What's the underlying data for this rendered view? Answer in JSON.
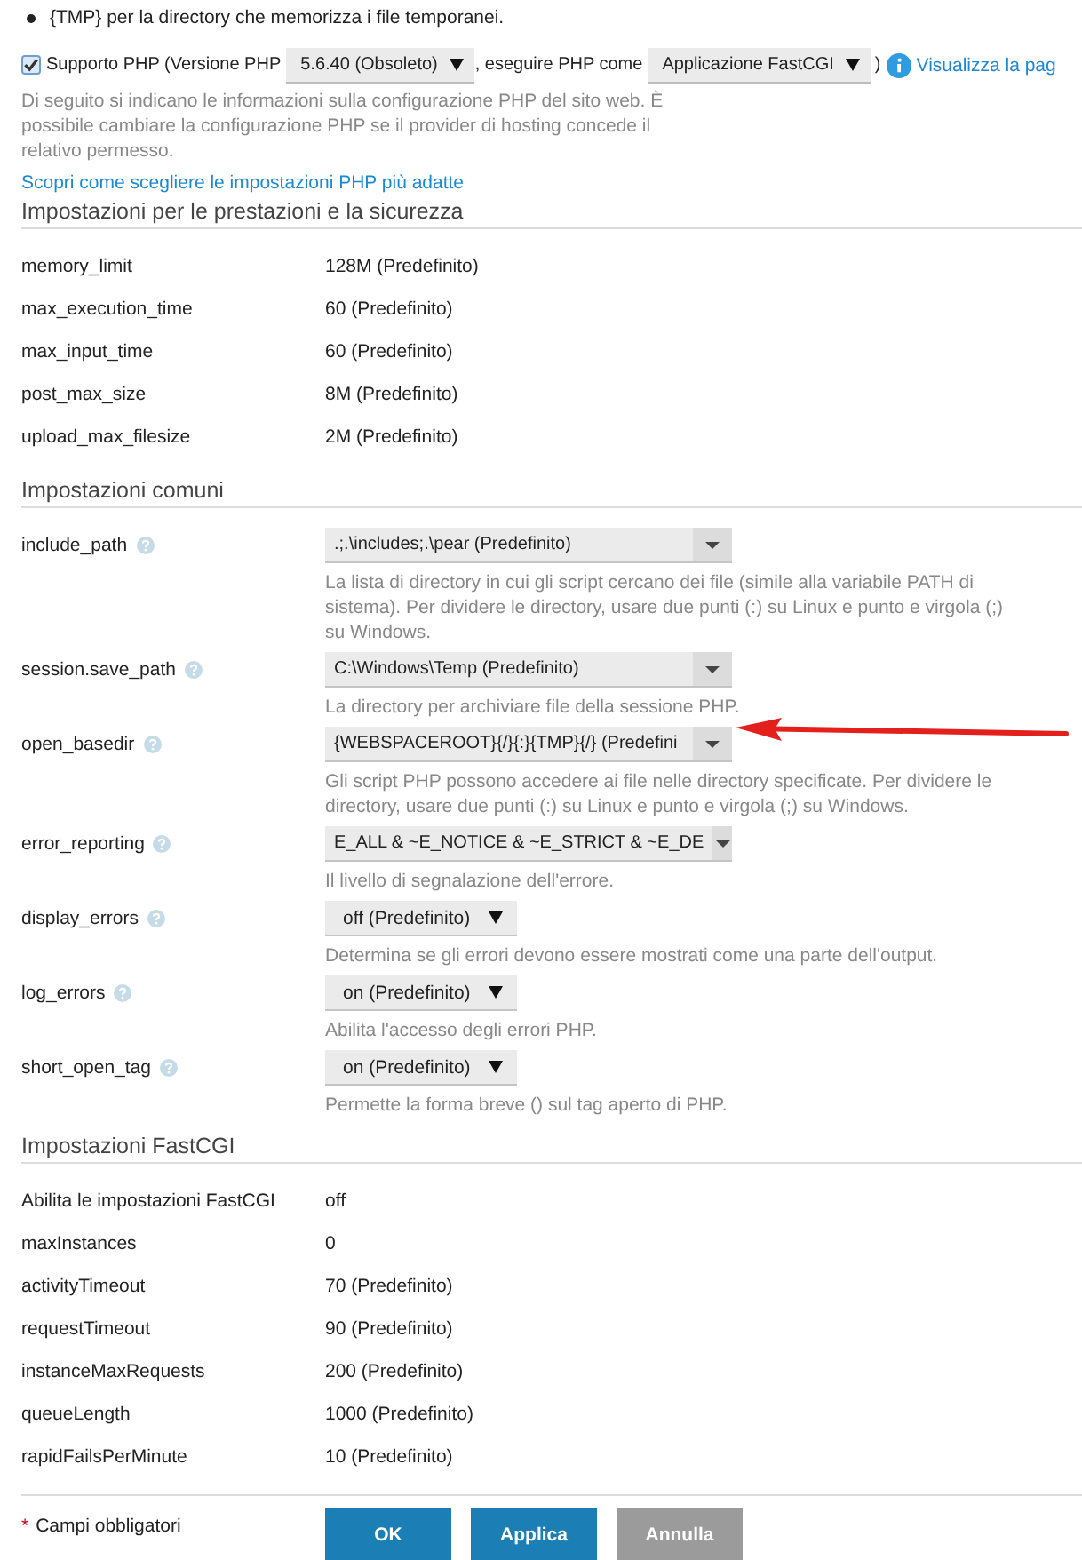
{
  "bullets": [
    "{TMP} per la directory che memorizza i file temporanei."
  ],
  "php_support": {
    "checked": true,
    "label": "Supporto PHP (Versione PHP",
    "version": "5.6.40 (Obsoleto)",
    "separator": ", eseguire PHP come",
    "handler": "Applicazione FastCGI",
    "closing": ")",
    "link": "Visualizza la pag"
  },
  "description": "Di seguito si indicano le informazioni sulla configurazione PHP del sito web. È possibile cambiare la configurazione PHP se il provider di hosting concede il relativo permesso.",
  "guide_link": "Scopri come scegliere le impostazioni PHP più adatte",
  "sections": [
    {
      "title": "Impostazioni per le prestazioni e la sicurezza",
      "rows": [
        {
          "kind": "text",
          "help": false,
          "name": "memory_limit",
          "value": "128M (Predefinito)"
        },
        {
          "kind": "text",
          "help": false,
          "name": "max_execution_time",
          "value": "60 (Predefinito)"
        },
        {
          "kind": "text",
          "help": false,
          "name": "max_input_time",
          "value": "60 (Predefinito)"
        },
        {
          "kind": "text",
          "help": false,
          "name": "post_max_size",
          "value": "8M (Predefinito)"
        },
        {
          "kind": "text",
          "help": false,
          "name": "upload_max_filesize",
          "value": "2M (Predefinito)"
        }
      ]
    },
    {
      "title": "Impostazioni comuni",
      "rows": [
        {
          "kind": "combo",
          "help": true,
          "name": "include_path",
          "value": ".;.\\includes;.\\pear (Predefinito)",
          "description": "La lista di directory in cui gli script cercano dei file (simile alla variabile PATH di sistema). Per dividere le directory, usare due punti (:) su Linux e punto e virgola (;) su Windows."
        },
        {
          "kind": "combo",
          "help": true,
          "name": "session.save_path",
          "value": "C:\\Windows\\Temp (Predefinito)",
          "description": "La directory per archiviare file della sessione PHP."
        },
        {
          "kind": "combo",
          "help": true,
          "name": "open_basedir",
          "value": "{WEBSPACEROOT}{/}{:}{TMP}{/} (Predefini",
          "description": "Gli script PHP possono accedere ai file nelle directory specificate. Per dividere le directory, usare due punti (:) su Linux e punto e virgola (;) su Windows."
        },
        {
          "kind": "combo",
          "help": true,
          "name": "error_reporting",
          "value": "E_ALL & ~E_NOTICE & ~E_STRICT & ~E_DE",
          "description": "Il livello di segnalazione dell'errore."
        },
        {
          "kind": "dropdown",
          "help": true,
          "name": "display_errors",
          "value": "off (Predefinito)",
          "description": "Determina se gli errori devono essere mostrati come una parte dell'output."
        },
        {
          "kind": "dropdown",
          "help": true,
          "name": "log_errors",
          "value": "on (Predefinito)",
          "description": "Abilita l'accesso degli errori PHP."
        },
        {
          "kind": "dropdown",
          "help": true,
          "name": "short_open_tag",
          "value": "on (Predefinito)",
          "description": "Permette la forma breve () sul tag aperto di PHP."
        }
      ]
    },
    {
      "title": "Impostazioni FastCGI",
      "rows": [
        {
          "kind": "text",
          "help": false,
          "name": "Abilita le impostazioni FastCGI",
          "value": "off"
        },
        {
          "kind": "text",
          "help": false,
          "name": "maxInstances",
          "value": "0"
        },
        {
          "kind": "text",
          "help": false,
          "name": "activityTimeout",
          "value": "70 (Predefinito)"
        },
        {
          "kind": "text",
          "help": false,
          "name": "requestTimeout",
          "value": "90 (Predefinito)"
        },
        {
          "kind": "text",
          "help": false,
          "name": "instanceMaxRequests",
          "value": "200 (Predefinito)"
        },
        {
          "kind": "text",
          "help": false,
          "name": "queueLength",
          "value": "1000 (Predefinito)"
        },
        {
          "kind": "text",
          "help": false,
          "name": "rapidFailsPerMinute",
          "value": "10 (Predefinito)"
        }
      ]
    }
  ],
  "footer": {
    "required_mark": "*",
    "required_note": "Campi obbligatori",
    "buttons": [
      {
        "label": "OK",
        "kind": "primary"
      },
      {
        "label": "Applica",
        "kind": "primary"
      },
      {
        "label": "Annulla",
        "kind": "secondary"
      }
    ]
  }
}
